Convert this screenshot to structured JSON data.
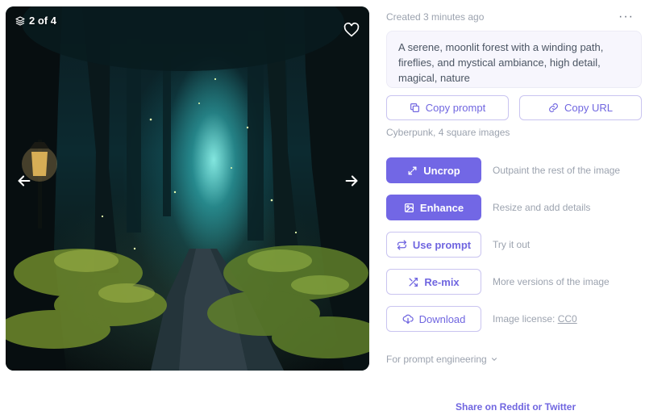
{
  "viewer": {
    "counter": "2 of 4",
    "icons": {
      "layers": "layers-icon",
      "favorite": "heart-icon",
      "prev": "arrow-left-icon",
      "next": "arrow-right-icon"
    }
  },
  "meta": {
    "created": "Created 3 minutes ago",
    "more": "···"
  },
  "prompt": "A serene, moonlit forest with a winding path, fireflies, and mystical ambiance, high detail, magical, nature",
  "copy": {
    "copy_prompt": "Copy prompt",
    "copy_url": "Copy URL"
  },
  "style_line": "Cyberpunk, 4 square images",
  "actions": [
    {
      "label": "Uncrop",
      "desc": "Outpaint the rest of the image",
      "icon": "expand-icon",
      "style": "solid"
    },
    {
      "label": "Enhance",
      "desc": "Resize and add details",
      "icon": "image-icon",
      "style": "solid"
    },
    {
      "label": "Use prompt",
      "desc": "Try it out",
      "icon": "repeat-icon",
      "style": "outline"
    },
    {
      "label": "Re-mix",
      "desc": "More versions of the image",
      "icon": "shuffle-icon",
      "style": "outline"
    },
    {
      "label": "Download",
      "desc": "Image license:",
      "license": "CC0",
      "icon": "cloud-download-icon",
      "style": "outline"
    }
  ],
  "engineering": "For prompt engineering",
  "share": "Share on Reddit or Twitter",
  "colors": {
    "accent": "#7267e5",
    "accent_text": "#7066e0",
    "muted": "#9ca3af"
  }
}
